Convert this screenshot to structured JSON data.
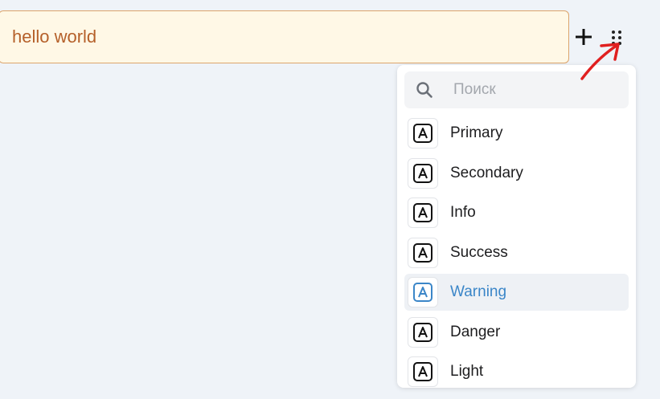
{
  "editor": {
    "block_text": "hello world",
    "add_symbol": "+"
  },
  "menu": {
    "search_placeholder": "Поиск",
    "items": [
      {
        "label": "Primary",
        "icon": "letter-a-icon"
      },
      {
        "label": "Secondary",
        "icon": "letter-a-icon"
      },
      {
        "label": "Info",
        "icon": "letter-a-icon"
      },
      {
        "label": "Success",
        "icon": "letter-a-icon"
      },
      {
        "label": "Warning",
        "icon": "letter-a-icon",
        "active": true
      },
      {
        "label": "Danger",
        "icon": "letter-a-icon"
      },
      {
        "label": "Light",
        "icon": "letter-a-icon"
      }
    ]
  },
  "colors": {
    "block_bg": "#fff8e6",
    "block_border": "#dca46b",
    "block_text": "#b5602a",
    "active_accent": "#3b86c8",
    "annotation_arrow": "#e02020"
  }
}
